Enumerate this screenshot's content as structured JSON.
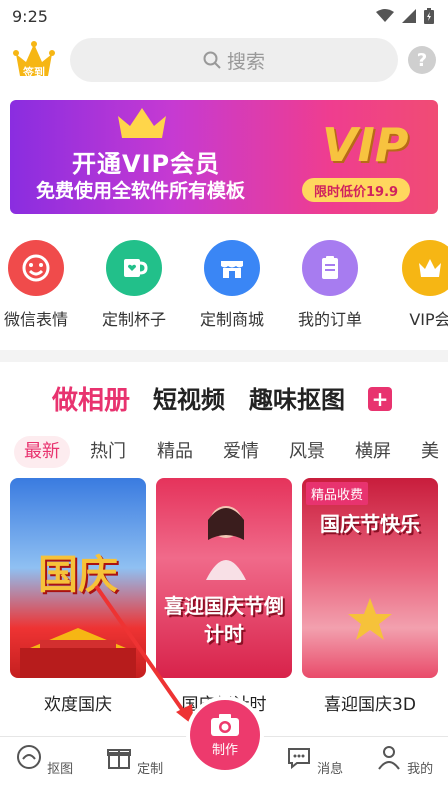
{
  "status": {
    "time": "9:25"
  },
  "header": {
    "sign_label": "签到",
    "search_placeholder": "搜索"
  },
  "banner": {
    "title": "开通VIP会员",
    "subtitle": "免费使用全软件所有模板",
    "vip_text": "VIP",
    "price_text": "限时低价19.9"
  },
  "quick_items": [
    {
      "label": "微信表情",
      "color": "#f04b4b",
      "icon": "smile-icon"
    },
    {
      "label": "定制杯子",
      "color": "#22c08a",
      "icon": "cup-icon"
    },
    {
      "label": "定制商城",
      "color": "#3a86f5",
      "icon": "shop-icon"
    },
    {
      "label": "我的订单",
      "color": "#a77cf0",
      "icon": "order-icon"
    },
    {
      "label": "VIP会",
      "color": "#f6b614",
      "icon": "vip-icon"
    }
  ],
  "categories": [
    "做相册",
    "短视频",
    "趣味抠图"
  ],
  "sub_tabs": [
    "最新",
    "热门",
    "精品",
    "爱情",
    "风景",
    "横屏",
    "美"
  ],
  "cards": [
    {
      "title": "欢度国庆",
      "poster": "国庆",
      "badge": ""
    },
    {
      "title": "国庆倒计时",
      "poster": "喜迎国庆节倒计时",
      "badge": ""
    },
    {
      "title": "喜迎国庆3D",
      "poster": "国庆节快乐",
      "badge": "精品收费"
    }
  ],
  "bottom_nav": [
    {
      "label": "抠图",
      "icon": "cutout-icon"
    },
    {
      "label": "定制",
      "icon": "gift-icon"
    },
    {
      "label": "制作",
      "icon": "camera-icon"
    },
    {
      "label": "消息",
      "icon": "message-icon"
    },
    {
      "label": "我的",
      "icon": "profile-icon"
    }
  ],
  "colors": {
    "accent": "#e8336f",
    "make_button": "#ed3a6d"
  }
}
